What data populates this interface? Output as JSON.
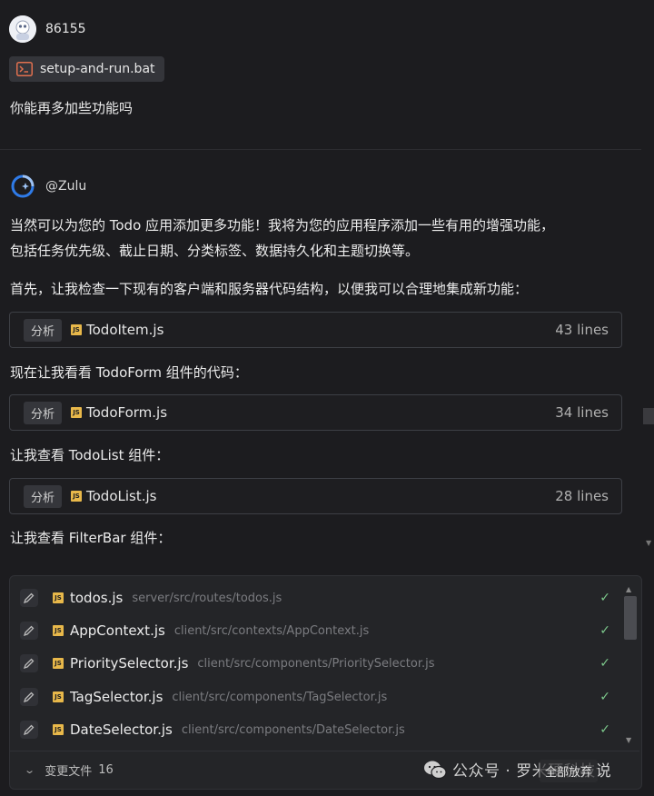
{
  "user": {
    "name": "86155"
  },
  "attachment": {
    "filename": "setup-and-run.bat",
    "icon": "terminal-file-icon"
  },
  "user_message": "你能再多加些功能吗",
  "assistant": {
    "name": "@Zulu"
  },
  "messages": {
    "intro_line1": "当然可以为您的 Todo 应用添加更多功能！我将为您的应用程序添加一些有用的增强功能，",
    "intro_line2": "包括任务优先级、截止日期、分类标签、数据持久化和主题切换等。",
    "check_line": "首先，让我检查一下现有的客户端和服务器代码结构，以便我可以合理地集成新功能：",
    "todoform_line": "现在让我看看 TodoForm 组件的代码：",
    "todolist_line": "让我查看 TodoList 组件：",
    "filterbar_line": "让我查看 FilterBar 组件："
  },
  "tool_calls": [
    {
      "badge": "分析",
      "file": "TodoItem.js",
      "lines": "43 lines"
    },
    {
      "badge": "分析",
      "file": "TodoForm.js",
      "lines": "34 lines"
    },
    {
      "badge": "分析",
      "file": "TodoList.js",
      "lines": "28 lines"
    }
  ],
  "changes": {
    "items": [
      {
        "name": "todos.js",
        "path": "server/src/routes/todos.js"
      },
      {
        "name": "AppContext.js",
        "path": "client/src/contexts/AppContext.js"
      },
      {
        "name": "PrioritySelector.js",
        "path": "client/src/components/PrioritySelector.js"
      },
      {
        "name": "TagSelector.js",
        "path": "client/src/components/TagSelector.js"
      },
      {
        "name": "DateSelector.js",
        "path": "client/src/components/DateSelector.js"
      }
    ],
    "footer_label": "变更文件",
    "footer_count": "16",
    "check_symbol": "✓"
  },
  "watermark": {
    "text": "公众号 · 罗米硬科技说",
    "overlay": "全部放弃"
  },
  "colors": {
    "js_icon": "#e8b84a",
    "check": "#7cc78b",
    "bat_icon": "#e0704f"
  }
}
